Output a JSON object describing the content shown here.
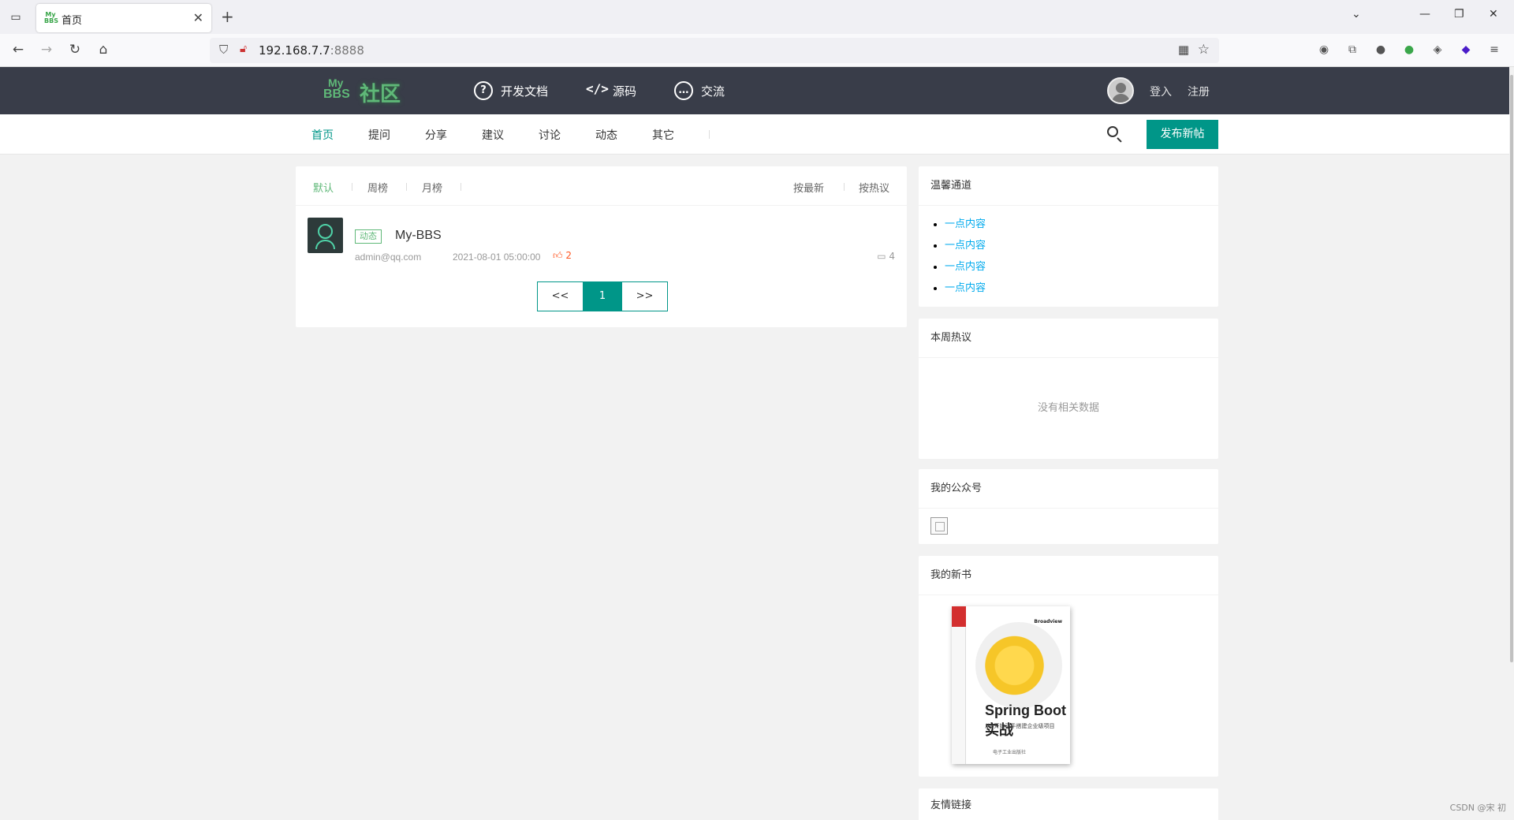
{
  "browser": {
    "tab_title": "首页",
    "url_host": "192.168.7.7",
    "url_port": ":8888"
  },
  "header": {
    "logo_small": "My",
    "logo_bbs": "BBS",
    "logo_text": "社区",
    "nav": [
      {
        "label": "开发文档",
        "icon": "question-circle-icon"
      },
      {
        "label": "源码",
        "icon": "code-icon"
      },
      {
        "label": "交流",
        "icon": "chat-circle-icon"
      }
    ],
    "login": "登入",
    "register": "注册"
  },
  "subnav": {
    "items": [
      "首页",
      "提问",
      "分享",
      "建议",
      "讨论",
      "动态",
      "其它"
    ],
    "active_index": 0,
    "post_button": "发布新帖"
  },
  "main": {
    "filters": [
      "默认",
      "周榜",
      "月榜"
    ],
    "sorts": [
      "按最新",
      "按热议"
    ],
    "posts": [
      {
        "badge": "动态",
        "title": "My-BBS",
        "author": "admin@qq.com",
        "time": "2021-08-01 05:00:00",
        "likes": "2",
        "comments": "4"
      }
    ],
    "pager": {
      "prev": "<<",
      "current": "1",
      "next": ">>"
    }
  },
  "sidebar": {
    "channel_title": "温馨通道",
    "channel_items": [
      "一点内容",
      "一点内容",
      "一点内容",
      "一点内容"
    ],
    "hot_title": "本周热议",
    "hot_empty": "没有相关数据",
    "wechat_title": "我的公众号",
    "book_title": "我的新书",
    "book_cover_title": "Spring Boot实战",
    "book_cover_subtitle": "从0开始动手搭建企业级项目",
    "links_title": "友情链接"
  },
  "watermark": "CSDN @宋 初",
  "colors": {
    "accent": "#009688",
    "green": "#5fb878",
    "header_bg": "#393d49",
    "link": "#01aaed",
    "like": "#ff5722"
  }
}
